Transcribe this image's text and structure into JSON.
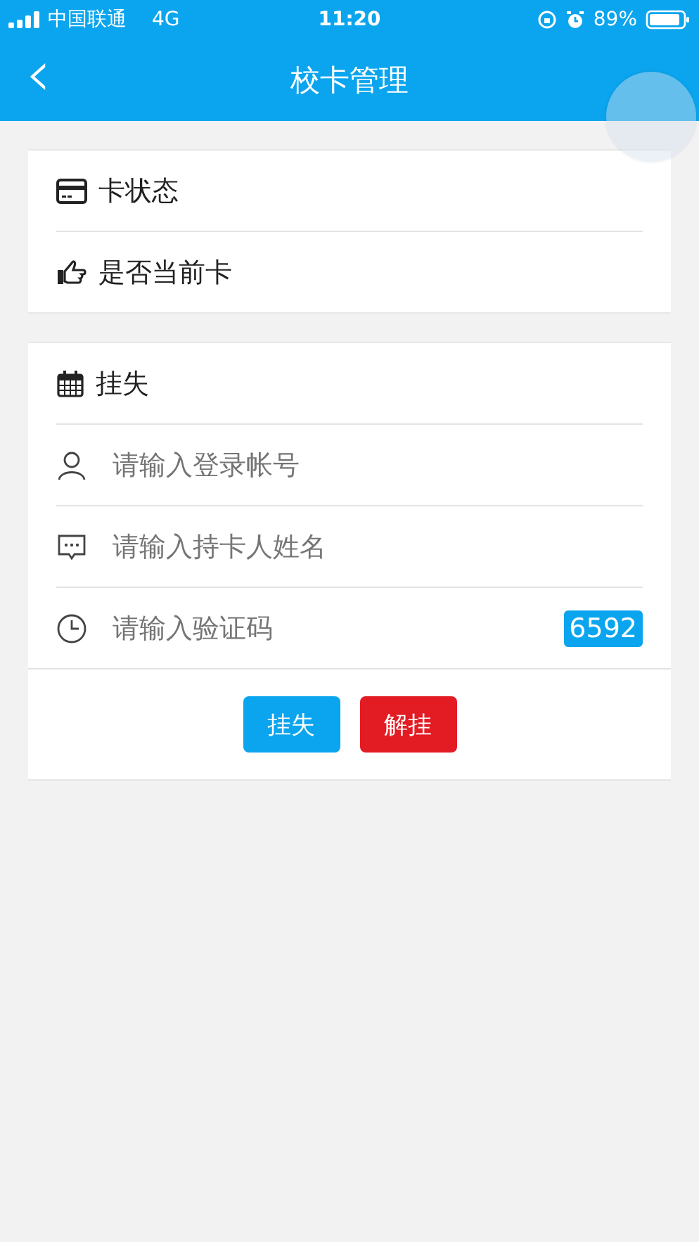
{
  "status_bar": {
    "carrier": "中国联通",
    "network": "4G",
    "time": "11:20",
    "battery": "89%"
  },
  "nav_bar": {
    "back": "‹",
    "title": "校卡管理"
  },
  "card_info": {
    "rows": [
      {
        "label": "卡状态"
      },
      {
        "label": "是否当前卡"
      }
    ]
  },
  "report_loss": {
    "header": {
      "label": "挂失"
    },
    "fields": [
      {
        "placeholder": "请输入登录帐号"
      },
      {
        "placeholder": "请输入持卡人姓名"
      },
      {
        "placeholder": "请输入验证码",
        "code": "6592"
      }
    ],
    "buttons": [
      {
        "label": "挂失",
        "color": "#0aa5ee"
      },
      {
        "label": "解挂",
        "color": "#e31b23"
      }
    ]
  }
}
